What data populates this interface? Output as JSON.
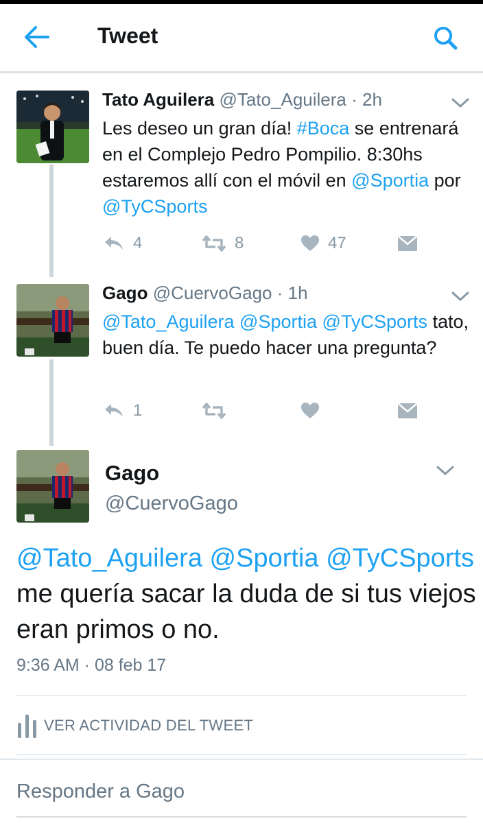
{
  "header": {
    "title": "Tweet"
  },
  "tweets": [
    {
      "name": "Tato Aguilera",
      "handle": "@Tato_Aguilera",
      "time": "· 2h",
      "text": {
        "p1": "Les deseo un gran día! ",
        "l1": "#Boca",
        "p2": " se entrenará en el Complejo Pedro Pompilio. 8:30hs estaremos allí  con el móvil en ",
        "l2": "@Sportia",
        "p3": " por ",
        "l3": "@TyCSports"
      },
      "replies": "4",
      "retweets": "8",
      "likes": "47"
    },
    {
      "name": "Gago",
      "handle": "@CuervoGago",
      "time": "· 1h",
      "text": {
        "l1": "@Tato_Aguilera",
        "s1": " ",
        "l2": "@Sportia",
        "s2": " ",
        "l3": "@TyCSports",
        "p1": " tato, buen día. Te puedo hacer una pregunta?"
      },
      "replies": "1"
    }
  ],
  "main_tweet": {
    "name": "Gago",
    "handle": "@CuervoGago",
    "text": {
      "l1": "@Tato_Aguilera",
      "s1": " ",
      "l2": "@Sportia",
      "s2": " ",
      "l3": "@TyCSports",
      "p1": " me quería sacar la duda de si tus viejos eran primos o no."
    },
    "timestamp": "9:36 AM · 08 feb 17"
  },
  "activity": {
    "label": "VER ACTIVIDAD DEL TWEET"
  },
  "reply": {
    "placeholder": "Responder a Gago"
  },
  "colors": {
    "link": "#1da1f2",
    "muted": "#8899a6",
    "text": "#14171a"
  },
  "icons": [
    "back-arrow-icon",
    "search-icon",
    "reply-icon",
    "retweet-icon",
    "like-icon",
    "direct-message-icon",
    "chevron-down-icon",
    "bar-chart-icon"
  ]
}
